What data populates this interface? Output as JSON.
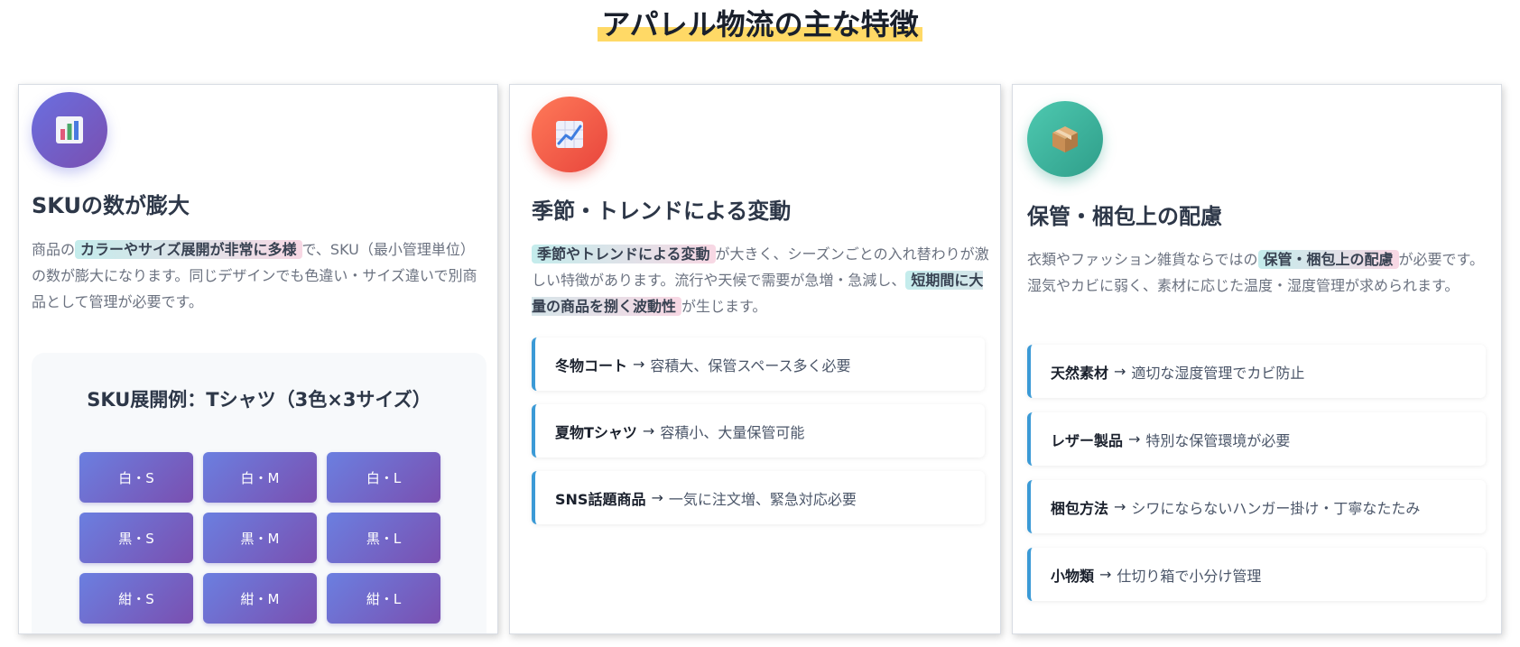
{
  "page": {
    "title": "アパレル物流の主な特徴"
  },
  "cards": [
    {
      "heading": "SKUの数が膨大",
      "icon": "bar-chart-icon",
      "desc": {
        "pre": "商品の",
        "highlight": "カラーやサイズ展開が非常に多様",
        "post": "で、SKU（最小管理単位）の数が膨大になります。同じデザインでも色違い・サイズ違いで別商品として管理が必要です。"
      },
      "sku_example": {
        "title": "SKU展開例：Tシャツ（3色×3サイズ）",
        "cells": [
          "白・S",
          "白・M",
          "白・L",
          "黒・S",
          "黒・M",
          "黒・L",
          "紺・S",
          "紺・M",
          "紺・L"
        ]
      }
    },
    {
      "heading": "季節・トレンドによる変動",
      "icon": "trend-chart-icon",
      "desc": {
        "highlight1": "季節やトレンドによる変動",
        "mid": "が大きく、シーズンごとの入れ替わりが激しい特徴があります。流行や天候で需要が急増・急減し、",
        "highlight2": "短期間に大量の商品を捌く波動性",
        "post": "が生じます。"
      },
      "points": [
        {
          "label": "冬物コート",
          "text": "容積大、保管スペース多く必要"
        },
        {
          "label": "夏物Tシャツ",
          "text": "容積小、大量保管可能"
        },
        {
          "label": "SNS話題商品",
          "text": "一気に注文増、緊急対応必要"
        }
      ]
    },
    {
      "heading": "保管・梱包上の配慮",
      "icon": "package-icon",
      "desc": {
        "pre": "衣類やファッション雑貨ならではの",
        "highlight": "保管・梱包上の配慮",
        "post": "が必要です。湿気やカビに弱く、素材に応じた温度・湿度管理が求められます。"
      },
      "points": [
        {
          "label": "天然素材",
          "text": "適切な湿度管理でカビ防止"
        },
        {
          "label": "レザー製品",
          "text": "特別な保管環境が必要"
        },
        {
          "label": "梱包方法",
          "text": "シワにならないハンガー掛け・丁寧なたたみ"
        },
        {
          "label": "小物類",
          "text": "仕切り箱で小分け管理"
        }
      ]
    }
  ],
  "arrow": "→",
  "colors": {
    "title_marker": "#ffd966",
    "card1_icon": [
      "#6a6fe0",
      "#7a4fb0"
    ],
    "card2_icon": [
      "#ff7a59",
      "#e8453c"
    ],
    "card3_icon": [
      "#4ec9b0",
      "#2f9e8a"
    ],
    "accent_border": "#3b9ad6"
  }
}
